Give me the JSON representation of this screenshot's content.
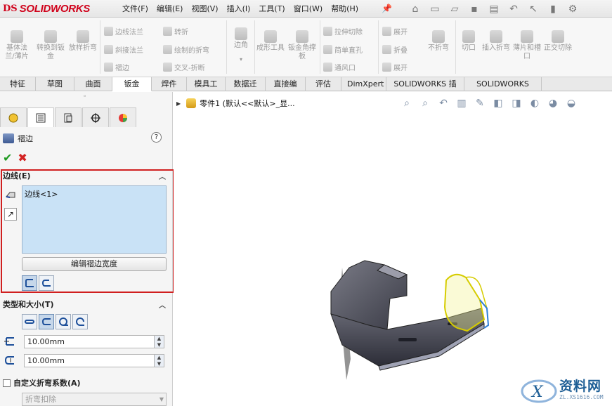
{
  "app": {
    "logo_prefix": "DS",
    "logo_name": "SOLIDWORKS"
  },
  "menu": [
    "文件(F)",
    "编辑(E)",
    "视图(V)",
    "插入(I)",
    "工具(T)",
    "窗口(W)",
    "帮助(H)"
  ],
  "ribbon": {
    "col1": [
      "基体法兰/薄片",
      "转换到钣金",
      "放样折弯"
    ],
    "col2": [
      "边线法兰",
      "斜接法兰",
      "褶边"
    ],
    "col3": [
      "转折",
      "绘制的折弯",
      "交叉-折断"
    ],
    "corner": "边角",
    "col4": [
      "成形工具",
      "钣金角撑板"
    ],
    "col5": [
      "拉伸切除",
      "简单直孔",
      "通风口"
    ],
    "col6": [
      "展开",
      "折叠",
      "展开"
    ],
    "unfold2": "不折弯",
    "col7": [
      "切口",
      "插入折弯",
      "薄片和槽口",
      "正交切除"
    ]
  },
  "tabs": [
    "特征",
    "草图",
    "曲面",
    "钣金",
    "焊件",
    "模具工具",
    "数据迁移",
    "直接编辑",
    "评估",
    "DimXpert",
    "SOLIDWORKS 插件",
    "SOLIDWORKS MBD"
  ],
  "active_tab": "钣金",
  "feature": {
    "title": "褶边",
    "help": "?",
    "edges_section": "边线(E)",
    "edge_items": [
      "边线<1>"
    ],
    "edit_width_button": "编辑褶边宽度",
    "type_section": "类型和大小(T)",
    "length_value": "10.00mm",
    "gap_value": "10.00mm",
    "custom_bend_label": "自定义折弯系数(A)",
    "bend_option": "折弯扣除"
  },
  "viewport": {
    "tree_label": "零件1 (默认<<默认>_显..."
  },
  "watermark": {
    "brand": "资料网",
    "url": "ZL.XS1616.COM"
  }
}
